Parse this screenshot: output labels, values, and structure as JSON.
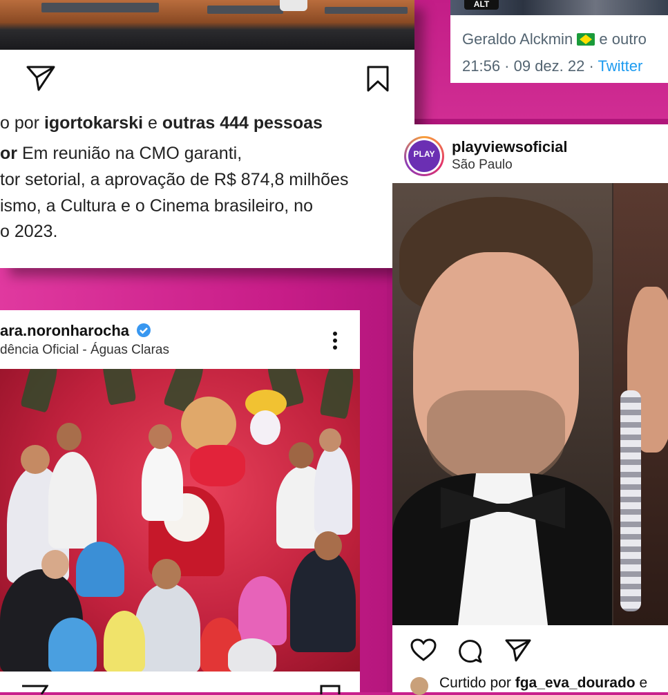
{
  "post1": {
    "liked_prefix": "o por ",
    "liked_user": "igortokarski",
    "liked_mid": " e ",
    "liked_others": "outras 444 pessoas",
    "caption_user": "or",
    "caption_lines": [
      " Em reunião na CMO garanti,",
      "tor setorial, a aprovação de R$ 874,8 milhões",
      "ismo, a Cultura e o Cinema brasileiro, no",
      "o 2023."
    ]
  },
  "tweet": {
    "badge": "ALT",
    "line1": "Geraldo Alckmin",
    "line1_suffix": " e outro",
    "time": "21:56 · 09 dez. 22 · ",
    "source": "Twitter"
  },
  "post2": {
    "username": "ara.noronharocha",
    "location": "dência Oficial - Águas Claras"
  },
  "post3": {
    "avatar_text": "PLAY",
    "username": "playviewsoficial",
    "location": "São Paulo",
    "liked_prefix": "Curtido por ",
    "liked_user": "fga_eva_dourado",
    "liked_suffix": " e"
  },
  "colors": {
    "magenta": "#c8208c",
    "verified": "#3897f0",
    "twitter_link": "#1d9bf0"
  }
}
